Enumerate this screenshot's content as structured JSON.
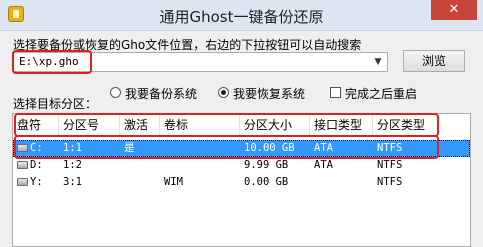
{
  "window": {
    "title": "通用Ghost一键备份还原",
    "close_glyph": "✕"
  },
  "file": {
    "prompt": "选择要备份或恢复的Gho文件位置，右边的下拉按钮可以自动搜索",
    "path": "E:\\xp.gho",
    "browse_label": "浏览"
  },
  "options": {
    "target_label": "选择目标分区：",
    "backup_label": "我要备份系统",
    "restore_label": "我要恢复系统",
    "selected": "restore",
    "reboot_label": "完成之后重启",
    "reboot_checked": false
  },
  "table": {
    "headers": [
      "盘符",
      "分区号",
      "激活",
      "卷标",
      "分区大小",
      "接口类型",
      "分区类型"
    ],
    "rows": [
      {
        "drive": "C:",
        "num": "1:1",
        "active": "是",
        "label": "",
        "size": "10.00 GB",
        "iface": "ATA",
        "type": "NTFS",
        "selected": true
      },
      {
        "drive": "D:",
        "num": "1:2",
        "active": "",
        "label": "",
        "size": "9.99 GB",
        "iface": "ATA",
        "type": "NTFS",
        "selected": false
      },
      {
        "drive": "Y:",
        "num": "3:1",
        "active": "",
        "label": "WIM",
        "size": "0.00 GB",
        "iface": "",
        "type": "NTFS",
        "selected": false
      }
    ]
  },
  "colors": {
    "highlight": "#e01f1f",
    "selection": "#3399ff",
    "close": "#c7443a"
  }
}
